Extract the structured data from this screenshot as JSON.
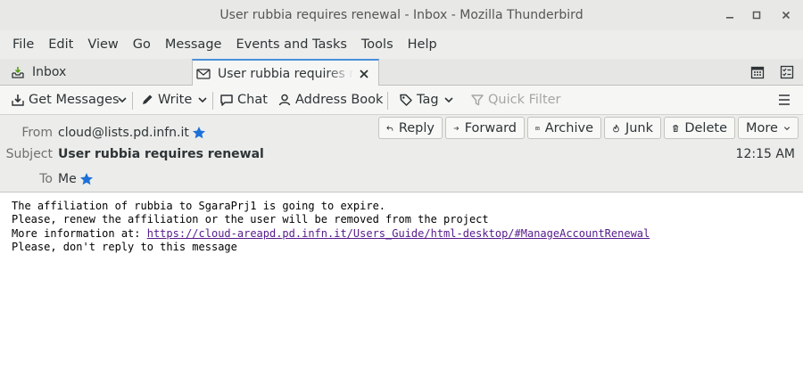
{
  "window": {
    "title": "User rubbia requires renewal - Inbox - Mozilla Thunderbird"
  },
  "menu": [
    {
      "label": "File"
    },
    {
      "label": "Edit"
    },
    {
      "label": "View"
    },
    {
      "label": "Go"
    },
    {
      "label": "Message"
    },
    {
      "label": "Events and Tasks"
    },
    {
      "label": "Tools"
    },
    {
      "label": "Help"
    }
  ],
  "tabs": {
    "inbox_label": "Inbox",
    "active_label": "User rubbia requires renewal"
  },
  "toolbar": {
    "get_messages": "Get Messages",
    "write": "Write",
    "chat": "Chat",
    "address_book": "Address Book",
    "tag": "Tag",
    "quick_filter": "Quick Filter"
  },
  "header": {
    "from_label": "From",
    "from_value": "cloud@lists.pd.infn.it",
    "subject_label": "Subject",
    "subject_value": "User rubbia requires renewal",
    "to_label": "To",
    "to_value": "Me",
    "date": "12:15 AM",
    "buttons": {
      "reply": "Reply",
      "forward": "Forward",
      "archive": "Archive",
      "junk": "Junk",
      "delete": "Delete",
      "more": "More"
    }
  },
  "body": {
    "line1": "The affiliation of rubbia to SgaraPrj1 is going to expire.",
    "line2": "Please, renew the affiliation or the user will be removed from the project",
    "line3_prefix": "More information at: ",
    "link": "https://cloud-areapd.pd.infn.it/Users_Guide/html-desktop/#ManageAccountRenewal",
    "line4": "Please, don't reply to this message"
  },
  "colors": {
    "star": "#1c71d8",
    "link": "#551a8b",
    "tab_accent": "#4a90d9"
  }
}
